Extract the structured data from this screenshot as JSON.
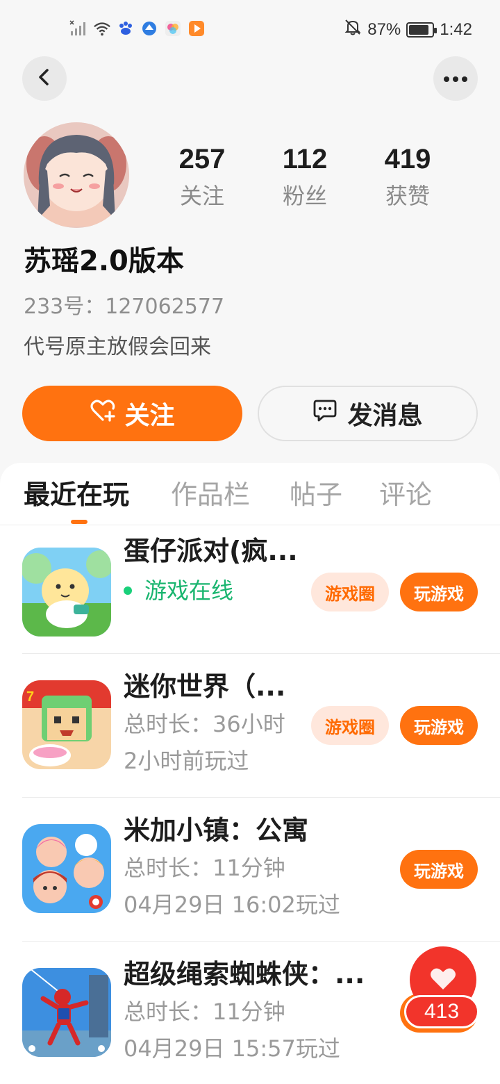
{
  "status_bar": {
    "battery_percent": "87%",
    "time": "1:42",
    "battery_level": 0.87
  },
  "profile": {
    "stats": [
      {
        "value": "257",
        "label": "关注"
      },
      {
        "value": "112",
        "label": "粉丝"
      },
      {
        "value": "419",
        "label": "获赞"
      }
    ],
    "nickname": "苏瑶2.0版本",
    "uid": "233号：127062577",
    "bio": "代号原主放假会回来",
    "follow_label": "关注",
    "message_label": "发消息"
  },
  "tabs": [
    {
      "label": "最近在玩",
      "active": true
    },
    {
      "label": "作品栏",
      "active": false
    },
    {
      "label": "帖子",
      "active": false
    },
    {
      "label": "评论",
      "active": false
    }
  ],
  "games": [
    {
      "title": "蛋仔派对(疯...",
      "line1": "游戏在线",
      "line2": "",
      "circle_label": "游戏圈",
      "play_label": "玩游戏"
    },
    {
      "title": "迷你世界（...",
      "line1": "总时长：36小时",
      "line2": "2小时前玩过",
      "circle_label": "游戏圈",
      "play_label": "玩游戏"
    },
    {
      "title": "米加小镇：公寓",
      "line1": "总时长：11分钟",
      "line2": "04月29日 16:02玩过",
      "circle_label": "",
      "play_label": "玩游戏"
    },
    {
      "title": "超级绳索蜘蛛侠：...",
      "line1": "总时长：11分钟",
      "line2": "04月29日 15:57玩过",
      "circle_label": "",
      "play_label": ""
    }
  ],
  "like_fab": {
    "count": "413"
  },
  "colors": {
    "accent": "#ff7210",
    "online": "#19b56f",
    "like": "#f2342b"
  }
}
